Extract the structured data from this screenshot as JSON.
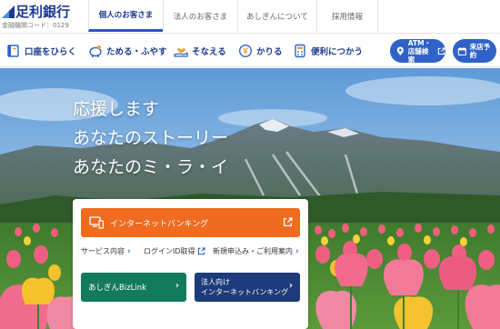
{
  "brand": {
    "name": "足利銀行",
    "code": "金融機関コード：0129"
  },
  "tabs": [
    {
      "label": "個人のお客さま",
      "active": true
    },
    {
      "label": "法人のお客さま",
      "active": false
    },
    {
      "label": "あしぎんについて",
      "active": false
    },
    {
      "label": "採用情報",
      "active": false
    }
  ],
  "nav": {
    "items": [
      {
        "label": "口座をひらく",
        "icon": "bankbook-icon"
      },
      {
        "label": "ためる・ふやす",
        "icon": "piggy-bank-icon"
      },
      {
        "label": "そなえる",
        "icon": "hand-heart-icon"
      },
      {
        "label": "かりる",
        "icon": "yen-coin-icon"
      },
      {
        "label": "便利につかう",
        "icon": "calculator-icon"
      }
    ],
    "atm_line1": "ATM・",
    "atm_line2": "店舗検索",
    "book_label": "来店予約"
  },
  "hero": {
    "line1": "応援します",
    "line2": "あなたのストーリー",
    "line3": "あなたのミ・ラ・イ"
  },
  "card": {
    "internet_banking": "インターネットバンキング",
    "links": [
      {
        "label": "サービス内容"
      },
      {
        "label": "ログインID取得"
      },
      {
        "label": "新規申込み・ご利用案内"
      }
    ],
    "bizlink": "あしぎんBizLink",
    "corp_line1": "法人向け",
    "corp_line2": "インターネットバンキング"
  },
  "colors": {
    "brand_blue": "#1d3a8f",
    "accent_blue": "#2f63c8",
    "orange": "#ef6b1f",
    "green": "#147a5c",
    "navy": "#1d3a7a"
  }
}
